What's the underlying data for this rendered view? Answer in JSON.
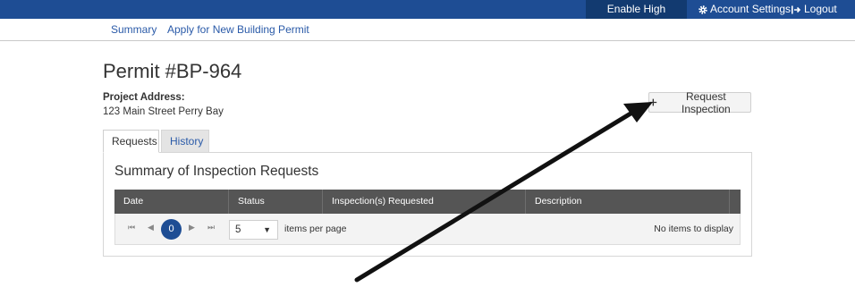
{
  "topbar": {
    "high_contrast": "Enable High Contrast",
    "account_settings": "Account Settings",
    "logout": "Logout",
    "color": "#1e4d94"
  },
  "subnav": {
    "summary": "Summary",
    "apply": "Apply for New Building Permit"
  },
  "permit": {
    "title": "Permit #BP-964",
    "address_label": "Project Address:",
    "address_value": "123 Main Street Perry Bay"
  },
  "actions": {
    "request_inspection": "Request Inspection"
  },
  "tabs": [
    {
      "label": "Requests",
      "active": true
    },
    {
      "label": "History",
      "active": false
    }
  ],
  "panel": {
    "title": "Summary of Inspection Requests",
    "columns": [
      "Date",
      "Status",
      "Inspection(s) Requested",
      "Description"
    ],
    "pager": {
      "current_page": "0",
      "page_size": "5",
      "items_per_page_label": "items per page",
      "empty_message": "No items to display"
    }
  },
  "icons": {
    "account": "gear-icon",
    "logout": "logout-icon",
    "add": "plus-icon",
    "pager_first": "first-page-icon",
    "pager_prev": "prev-page-icon",
    "pager_next": "next-page-icon",
    "pager_last": "last-page-icon",
    "dropdown": "caret-down-icon"
  }
}
